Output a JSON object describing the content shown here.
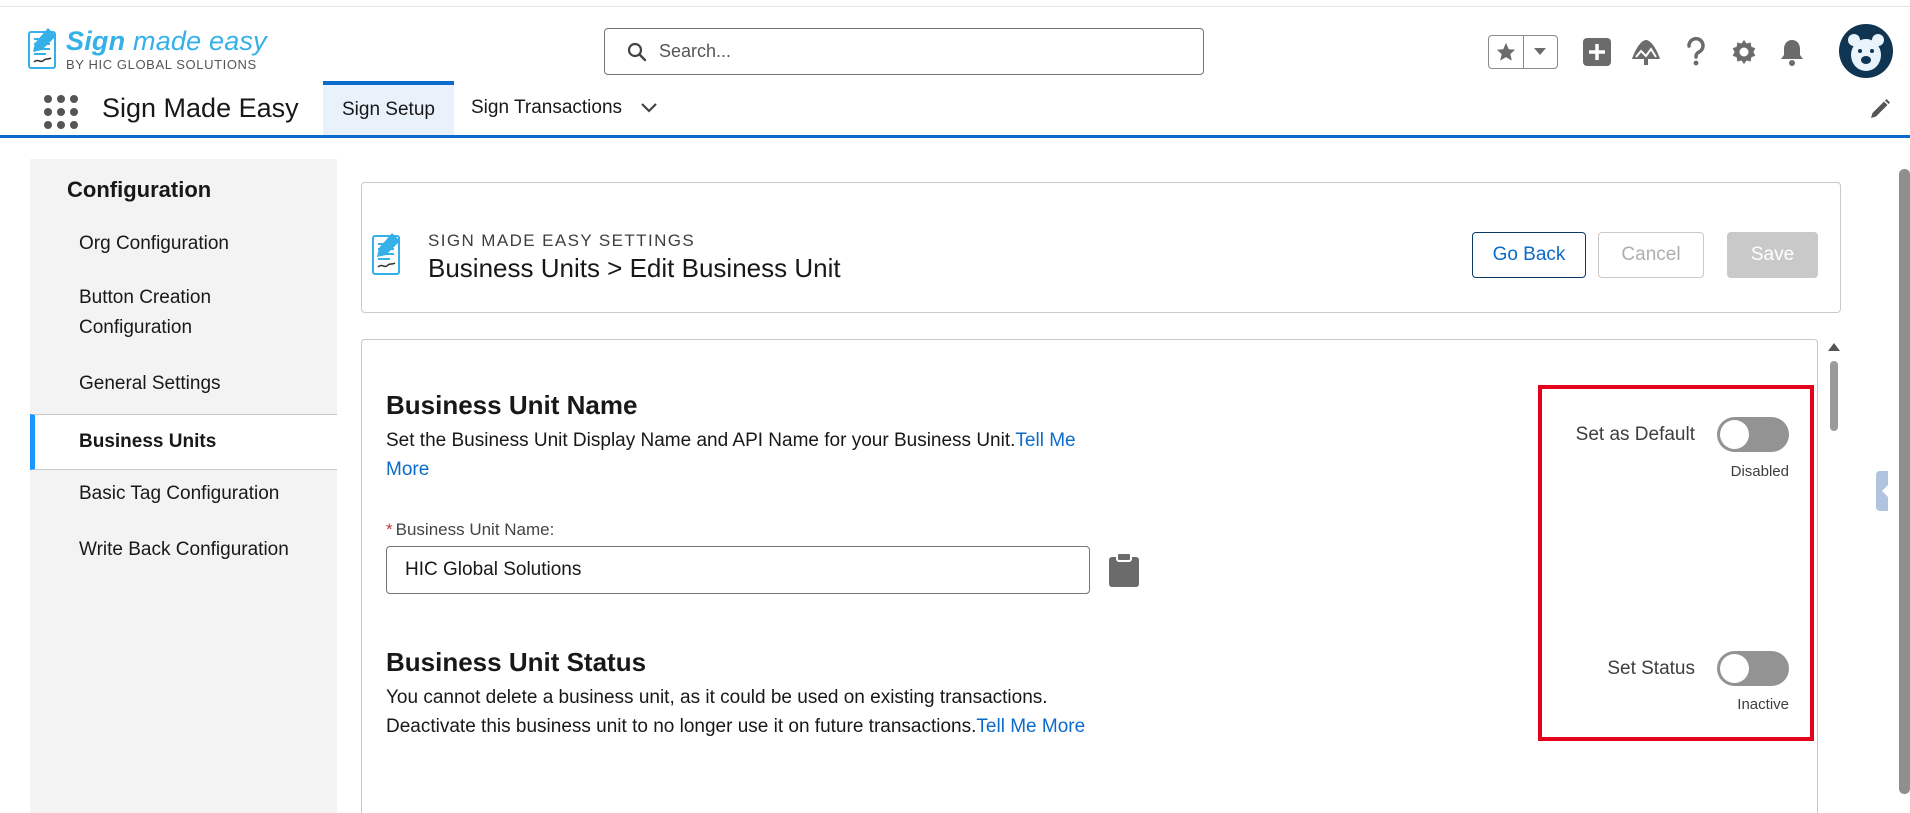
{
  "header": {
    "logo_main": "Sign",
    "logo_main_italic": " made easy",
    "logo_sub": "BY HIC GLOBAL SOLUTIONS",
    "search_placeholder": "Search..."
  },
  "app_nav": {
    "app_name": "Sign Made Easy",
    "tabs": [
      {
        "label": "Sign Setup",
        "active": true
      },
      {
        "label": "Sign Transactions",
        "active": false
      }
    ]
  },
  "sidebar": {
    "title": "Configuration",
    "items": [
      {
        "label": "Org Configuration"
      },
      {
        "label": "Button Creation Configuration"
      },
      {
        "label": "General Settings"
      },
      {
        "label": "Business Units",
        "active": true
      },
      {
        "label": "Basic Tag Configuration"
      },
      {
        "label": "Write Back Configuration"
      }
    ]
  },
  "page_header": {
    "eyebrow": "SIGN MADE EASY SETTINGS",
    "breadcrumb": "Business Units > Edit Business Unit",
    "buttons": {
      "back": "Go Back",
      "cancel": "Cancel",
      "save": "Save"
    }
  },
  "form": {
    "name_section": {
      "title": "Business Unit Name",
      "description": "Set the Business Unit Display Name and API Name for your Business Unit.",
      "link": "Tell Me More",
      "field_label": "Business Unit Name:",
      "field_value": "HIC Global Solutions"
    },
    "status_section": {
      "title": "Business Unit Status",
      "description": "You cannot delete a business unit, as it could be used on existing transactions. Deactivate this business unit to no longer use it on future transactions.",
      "link": "Tell Me More"
    },
    "toggles": {
      "default": {
        "label": "Set as Default",
        "state": "Disabled",
        "on": false
      },
      "status": {
        "label": "Set Status",
        "state": "Inactive",
        "on": false
      }
    }
  },
  "colors": {
    "brand_blue": "#0b6bcb",
    "logo_blue": "#36b0e8",
    "highlight_red": "#e5001b",
    "toggle_off": "#939393"
  }
}
